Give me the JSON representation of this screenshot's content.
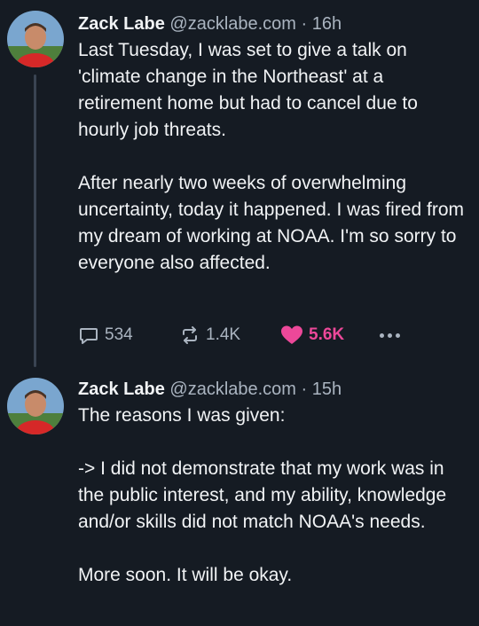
{
  "posts": [
    {
      "author_name": "Zack Labe",
      "handle": "@zacklabe.com",
      "separator": "·",
      "time": "16h",
      "paragraphs": [
        "Last Tuesday, I was set to give a talk on 'climate change in the Northeast' at a retirement home but had to cancel due to hourly job threats.",
        "After nearly two weeks of overwhelming uncertainty, today it happened. I was fired from my dream of working at NOAA. I'm so sorry to everyone also affected."
      ],
      "reply_count": "534",
      "repost_count": "1.4K",
      "like_count": "5.6K"
    },
    {
      "author_name": "Zack Labe",
      "handle": "@zacklabe.com",
      "separator": "·",
      "time": "15h",
      "paragraphs": [
        "The reasons I was given:",
        "-> I did not demonstrate that my work was in the public interest, and my ability, knowledge and/or skills did not match NOAA's needs.",
        "More soon. It will be okay."
      ]
    }
  ],
  "icons": {
    "reply": "reply-bubble-icon",
    "repost": "repost-arrows-icon",
    "like": "heart-icon",
    "more": "more-dots-icon"
  },
  "colors": {
    "background": "#151b23",
    "text": "#f1f3f5",
    "muted": "#aab4c0",
    "like": "#ec4899",
    "thread_line": "#3a4452"
  }
}
